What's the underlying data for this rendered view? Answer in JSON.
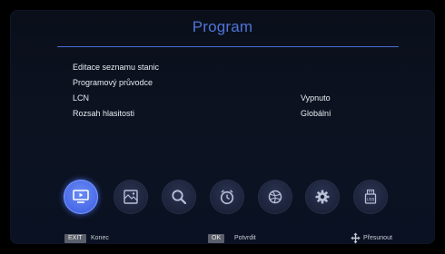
{
  "title": "Program",
  "menu": [
    {
      "label": "Editace seznamu stanic",
      "value": ""
    },
    {
      "label": "Programový průvodce",
      "value": ""
    },
    {
      "label": "LCN",
      "value": "Vypnuto"
    },
    {
      "label": "Rozsah hlasitosti",
      "value": "Globální"
    }
  ],
  "icons": [
    {
      "name": "tv-program-icon",
      "active": true
    },
    {
      "name": "picture-icon",
      "active": false
    },
    {
      "name": "search-icon",
      "active": false
    },
    {
      "name": "clock-icon",
      "active": false
    },
    {
      "name": "globe-icon",
      "active": false
    },
    {
      "name": "settings-gear-icon",
      "active": false
    },
    {
      "name": "usb-icon",
      "active": false
    }
  ],
  "footer": {
    "exit_key": "EXIT",
    "exit_label": "Konec",
    "ok_key": "OK",
    "ok_label": "Potvrdit",
    "move_label": "Přesunout"
  },
  "colors": {
    "accent": "#4f74d9",
    "active_icon": "#5b7cf0",
    "background": "#0b1120"
  }
}
